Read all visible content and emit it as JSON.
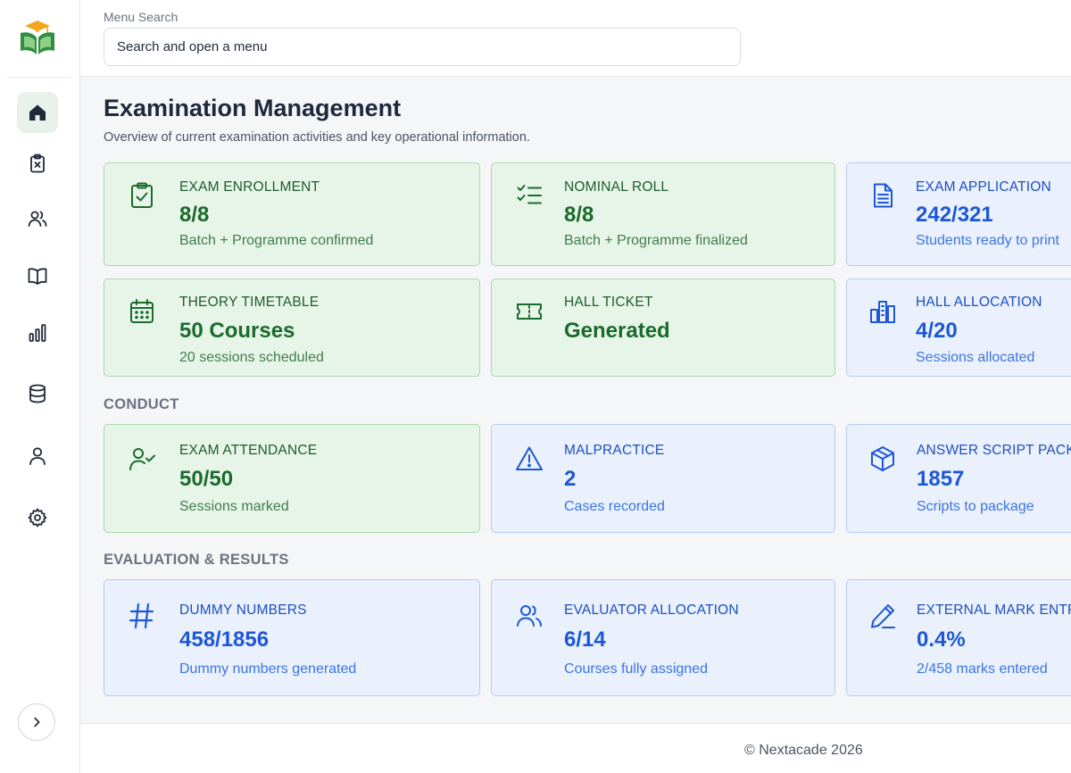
{
  "search": {
    "label": "Menu Search",
    "placeholder": "Search and open a menu"
  },
  "page": {
    "title": "Examination Management",
    "subtitle": "Overview of current examination activities and key operational information."
  },
  "sidebar": {
    "items": [
      {
        "icon": "home-icon",
        "active": true
      },
      {
        "icon": "clipboard-x-icon",
        "active": false
      },
      {
        "icon": "users-icon",
        "active": false
      },
      {
        "icon": "book-open-icon",
        "active": false
      },
      {
        "icon": "bar-chart-icon",
        "active": false
      },
      {
        "icon": "database-icon",
        "active": false
      },
      {
        "icon": "user-icon",
        "active": false
      },
      {
        "icon": "settings-icon",
        "active": false
      }
    ],
    "expand_icon": "chevron-right-icon"
  },
  "sections": {
    "conduct": "CONDUCT",
    "evaluation": "EVALUATION & RESULTS"
  },
  "cards": {
    "exam_enrollment": {
      "title": "EXAM ENROLLMENT",
      "value": "8/8",
      "sub": "Batch + Programme confirmed",
      "icon": "clipboard-check-icon",
      "theme": "green"
    },
    "nominal_roll": {
      "title": "NOMINAL ROLL",
      "value": "8/8",
      "sub": "Batch + Programme finalized",
      "icon": "list-checks-icon",
      "theme": "green"
    },
    "exam_application": {
      "title": "EXAM APPLICATION",
      "value": "242/321",
      "sub": "Students ready to print",
      "icon": "file-text-icon",
      "theme": "blue"
    },
    "theory_timetable": {
      "title": "THEORY TIMETABLE",
      "value": "50 Courses",
      "sub": "20 sessions scheduled",
      "icon": "calendar-icon",
      "theme": "green"
    },
    "hall_ticket": {
      "title": "HALL TICKET",
      "value": "Generated",
      "sub": "",
      "icon": "ticket-icon",
      "theme": "green"
    },
    "hall_allocation": {
      "title": "HALL ALLOCATION",
      "value": "4/20",
      "sub": "Sessions allocated",
      "icon": "building-icon",
      "theme": "blue"
    },
    "exam_attendance": {
      "title": "EXAM ATTENDANCE",
      "value": "50/50",
      "sub": "Sessions marked",
      "icon": "user-check-icon",
      "theme": "green"
    },
    "malpractice": {
      "title": "MALPRACTICE",
      "value": "2",
      "sub": "Cases recorded",
      "icon": "alert-triangle-icon",
      "theme": "blue"
    },
    "answer_script": {
      "title": "ANSWER SCRIPT PACKING",
      "value": "1857",
      "sub": "Scripts to package",
      "icon": "package-icon",
      "theme": "blue"
    },
    "dummy_numbers": {
      "title": "DUMMY NUMBERS",
      "value": "458/1856",
      "sub": "Dummy numbers generated",
      "icon": "hash-icon",
      "theme": "blue"
    },
    "evaluator_allocation": {
      "title": "EVALUATOR ALLOCATION",
      "value": "6/14",
      "sub": "Courses fully assigned",
      "icon": "users-icon",
      "theme": "blue"
    },
    "external_mark": {
      "title": "EXTERNAL MARK ENTRY",
      "value": "0.4%",
      "sub": "2/458 marks entered",
      "icon": "pen-icon",
      "theme": "blue"
    }
  },
  "colors": {
    "green_accent": "#1b6b2c",
    "blue_accent": "#1d57d6",
    "active_nav": "#e8f2ea"
  },
  "footer": {
    "text": "© Nextacade 2026"
  }
}
